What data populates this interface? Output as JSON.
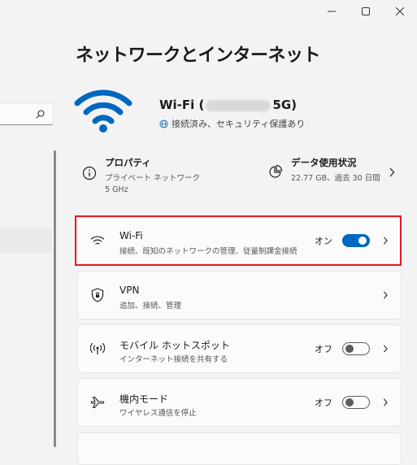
{
  "page": {
    "title": "ネットワークとインターネット"
  },
  "hero": {
    "name_prefix": "Wi-Fi (",
    "name_suffix": "5G)",
    "status": "接続済み、セキュリティ保護あり"
  },
  "properties": {
    "title": "プロパティ",
    "line1": "プライベート ネットワーク",
    "line2": "5 GHz"
  },
  "data_usage": {
    "title": "データ使用状況",
    "detail": "22.77 GB、過去 30 日間"
  },
  "cards": [
    {
      "title": "Wi-Fi",
      "subtitle": "接続、既知のネットワークの管理、従量制課金接続",
      "state": "オン",
      "toggle": "on"
    },
    {
      "title": "VPN",
      "subtitle": "追加、接続、管理"
    },
    {
      "title": "モバイル ホットスポット",
      "subtitle": "インターネット接続を共有する",
      "state": "オフ",
      "toggle": "off"
    },
    {
      "title": "機内モード",
      "subtitle": "ワイヤレス通信を停止",
      "state": "オフ",
      "toggle": "off"
    }
  ],
  "colors": {
    "accent": "#0067c0",
    "highlight": "#e01b24",
    "background": "#f3f3f3",
    "card": "#fbfbfb"
  }
}
